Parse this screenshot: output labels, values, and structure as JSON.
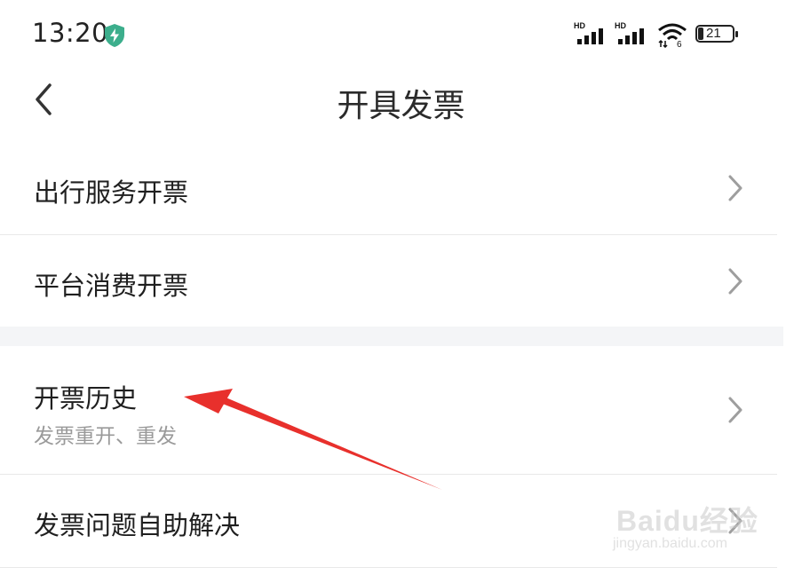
{
  "status_bar": {
    "time": "13:20",
    "network_label_1": "HD",
    "network_label_2": "HD",
    "wifi_tag": "6",
    "battery_level": "21",
    "shield_color": "#3cae8c"
  },
  "nav": {
    "title": "开具发票",
    "back_icon": "chevron-left-icon"
  },
  "menu": {
    "items": [
      {
        "label": "出行服务开票"
      },
      {
        "label": "平台消费开票"
      },
      {
        "label": "开票历史",
        "sub": "发票重开、重发"
      },
      {
        "label": "发票问题自助解决"
      }
    ]
  },
  "annotation": {
    "arrow_color": "#e8302c"
  },
  "watermark": {
    "brand": "Baidu经验",
    "url": "jingyan.baidu.com"
  }
}
